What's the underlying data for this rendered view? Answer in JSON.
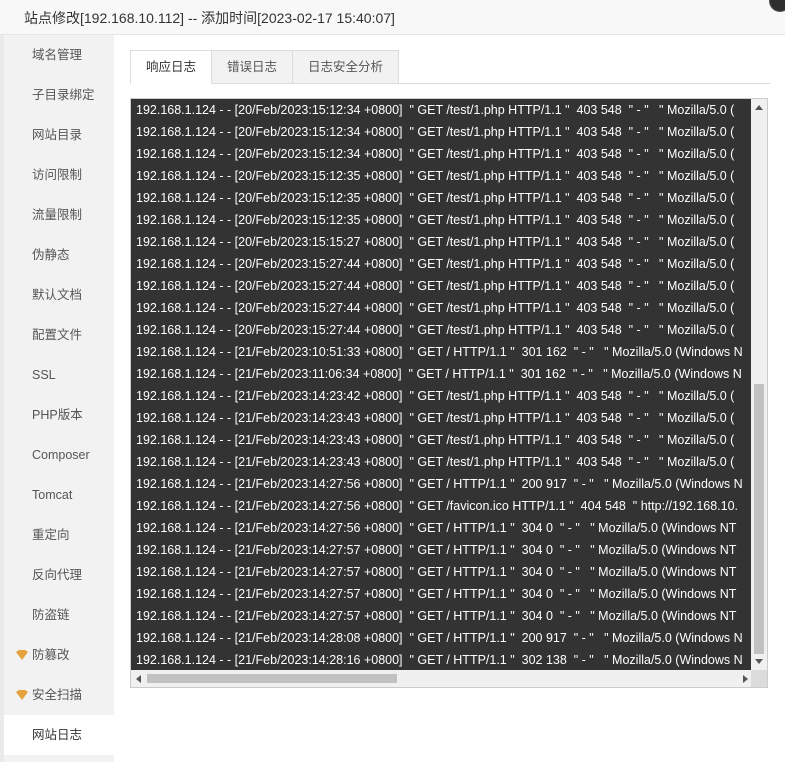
{
  "window": {
    "title": "站点修改[192.168.10.112] -- 添加时间[2023-02-17 15:40:07]"
  },
  "sidebar": {
    "items": [
      {
        "label": "域名管理"
      },
      {
        "label": "子目录绑定"
      },
      {
        "label": "网站目录"
      },
      {
        "label": "访问限制"
      },
      {
        "label": "流量限制"
      },
      {
        "label": "伪静态"
      },
      {
        "label": "默认文档"
      },
      {
        "label": "配置文件"
      },
      {
        "label": "SSL"
      },
      {
        "label": "PHP版本"
      },
      {
        "label": "Composer"
      },
      {
        "label": "Tomcat"
      },
      {
        "label": "重定向"
      },
      {
        "label": "反向代理"
      },
      {
        "label": "防盗链"
      },
      {
        "label": "防篡改",
        "icon": "diamond-vip-icon"
      },
      {
        "label": "安全扫描",
        "icon": "diamond-vip-icon"
      },
      {
        "label": "网站日志",
        "active": true
      }
    ]
  },
  "tabs": [
    {
      "label": "响应日志",
      "active": true
    },
    {
      "label": "错误日志"
    },
    {
      "label": "日志安全分析"
    }
  ],
  "log": {
    "lines": [
      "192.168.1.124 - - [20/Feb/2023:15:12:34 +0800]  \" GET /test/1.php HTTP/1.1 \"  403 548  \" - \"   \" Mozilla/5.0 (",
      "192.168.1.124 - - [20/Feb/2023:15:12:34 +0800]  \" GET /test/1.php HTTP/1.1 \"  403 548  \" - \"   \" Mozilla/5.0 (",
      "192.168.1.124 - - [20/Feb/2023:15:12:34 +0800]  \" GET /test/1.php HTTP/1.1 \"  403 548  \" - \"   \" Mozilla/5.0 (",
      "192.168.1.124 - - [20/Feb/2023:15:12:35 +0800]  \" GET /test/1.php HTTP/1.1 \"  403 548  \" - \"   \" Mozilla/5.0 (",
      "192.168.1.124 - - [20/Feb/2023:15:12:35 +0800]  \" GET /test/1.php HTTP/1.1 \"  403 548  \" - \"   \" Mozilla/5.0 (",
      "192.168.1.124 - - [20/Feb/2023:15:12:35 +0800]  \" GET /test/1.php HTTP/1.1 \"  403 548  \" - \"   \" Mozilla/5.0 (",
      "192.168.1.124 - - [20/Feb/2023:15:15:27 +0800]  \" GET /test/1.php HTTP/1.1 \"  403 548  \" - \"   \" Mozilla/5.0 (",
      "192.168.1.124 - - [20/Feb/2023:15:27:44 +0800]  \" GET /test/1.php HTTP/1.1 \"  403 548  \" - \"   \" Mozilla/5.0 (",
      "192.168.1.124 - - [20/Feb/2023:15:27:44 +0800]  \" GET /test/1.php HTTP/1.1 \"  403 548  \" - \"   \" Mozilla/5.0 (",
      "192.168.1.124 - - [20/Feb/2023:15:27:44 +0800]  \" GET /test/1.php HTTP/1.1 \"  403 548  \" - \"   \" Mozilla/5.0 (",
      "192.168.1.124 - - [20/Feb/2023:15:27:44 +0800]  \" GET /test/1.php HTTP/1.1 \"  403 548  \" - \"   \" Mozilla/5.0 (",
      "192.168.1.124 - - [21/Feb/2023:10:51:33 +0800]  \" GET / HTTP/1.1 \"  301 162  \" - \"   \" Mozilla/5.0 (Windows N",
      "192.168.1.124 - - [21/Feb/2023:11:06:34 +0800]  \" GET / HTTP/1.1 \"  301 162  \" - \"   \" Mozilla/5.0 (Windows N",
      "192.168.1.124 - - [21/Feb/2023:14:23:42 +0800]  \" GET /test/1.php HTTP/1.1 \"  403 548  \" - \"   \" Mozilla/5.0 (",
      "192.168.1.124 - - [21/Feb/2023:14:23:43 +0800]  \" GET /test/1.php HTTP/1.1 \"  403 548  \" - \"   \" Mozilla/5.0 (",
      "192.168.1.124 - - [21/Feb/2023:14:23:43 +0800]  \" GET /test/1.php HTTP/1.1 \"  403 548  \" - \"   \" Mozilla/5.0 (",
      "192.168.1.124 - - [21/Feb/2023:14:23:43 +0800]  \" GET /test/1.php HTTP/1.1 \"  403 548  \" - \"   \" Mozilla/5.0 (",
      "192.168.1.124 - - [21/Feb/2023:14:27:56 +0800]  \" GET / HTTP/1.1 \"  200 917  \" - \"   \" Mozilla/5.0 (Windows N",
      "192.168.1.124 - - [21/Feb/2023:14:27:56 +0800]  \" GET /favicon.ico HTTP/1.1 \"  404 548  \" http://192.168.10.",
      "192.168.1.124 - - [21/Feb/2023:14:27:56 +0800]  \" GET / HTTP/1.1 \"  304 0  \" - \"   \" Mozilla/5.0 (Windows NT",
      "192.168.1.124 - - [21/Feb/2023:14:27:57 +0800]  \" GET / HTTP/1.1 \"  304 0  \" - \"   \" Mozilla/5.0 (Windows NT",
      "192.168.1.124 - - [21/Feb/2023:14:27:57 +0800]  \" GET / HTTP/1.1 \"  304 0  \" - \"   \" Mozilla/5.0 (Windows NT",
      "192.168.1.124 - - [21/Feb/2023:14:27:57 +0800]  \" GET / HTTP/1.1 \"  304 0  \" - \"   \" Mozilla/5.0 (Windows NT",
      "192.168.1.124 - - [21/Feb/2023:14:27:57 +0800]  \" GET / HTTP/1.1 \"  304 0  \" - \"   \" Mozilla/5.0 (Windows NT",
      "192.168.1.124 - - [21/Feb/2023:14:28:08 +0800]  \" GET / HTTP/1.1 \"  200 917  \" - \"   \" Mozilla/5.0 (Windows N",
      "192.168.1.124 - - [21/Feb/2023:14:28:16 +0800]  \" GET / HTTP/1.1 \"  302 138  \" - \"   \" Mozilla/5.0 (Windows N"
    ],
    "vertical_scroll_position": 1.0,
    "horizontal_scroll_position": 0.0
  },
  "colors": {
    "log_background": "#333333",
    "log_text": "#ffffff",
    "vip_icon": "#e6a23c"
  }
}
